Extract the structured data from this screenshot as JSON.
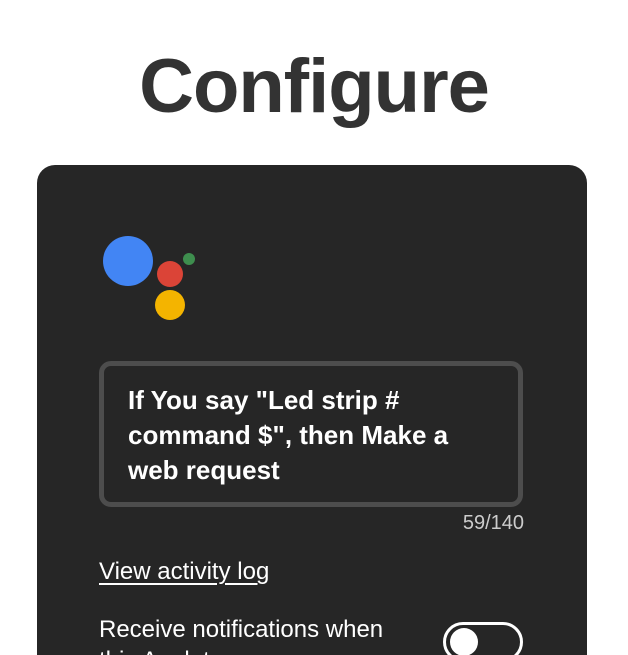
{
  "page": {
    "title": "Configure"
  },
  "applet": {
    "logo_icon": "google-assistant-icon",
    "logo_colors": {
      "blue": "#4285f4",
      "red": "#db4437",
      "yellow": "#f4b400",
      "green": "#3e8e4e"
    },
    "description": "If You say \"Led strip # command $\", then Make a web request",
    "char_count": "59/140",
    "activity_log_link": "View activity log",
    "notifications": {
      "label": "Receive notifications when this Applet runs",
      "enabled": false
    }
  }
}
